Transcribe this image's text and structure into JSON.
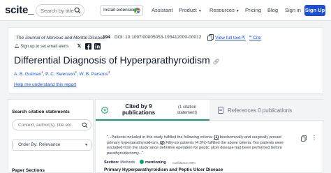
{
  "nav": {
    "logo": "scite_",
    "search_placeholder": "Search by title, ...",
    "extension_label": "Install extension!",
    "items": [
      "Assistant",
      "Product",
      "Resources",
      "Pricing",
      "Blog"
    ],
    "signin": "Sign in",
    "signup": "Sign Up"
  },
  "article": {
    "journal": "The Journal of Nervous and Mental Disease",
    "volume": "194",
    "doi": "DOI: 10.1097/00005053-193412000-00012",
    "full_text": "View full text",
    "cite": "Cite",
    "alerts": "Sign up to set email alerts",
    "title": "Differential Diagnosis of Hyperparathyroidism",
    "authors": [
      {
        "name": "A. B. Gutman",
        "sup": "1"
      },
      {
        "name": "P. C. Swenson",
        "sup": "2"
      },
      {
        "name": "W. B. Parsons",
        "sup": "3"
      }
    ],
    "help": "Help me understand this report"
  },
  "sidebar": {
    "search_title": "Search citation statements",
    "context_placeholder": "Context, author(s), title etc.",
    "order": "Order By: Relevance",
    "sections": "Paper Sections"
  },
  "panel": {
    "tab_cited_main": "Cited by 9 publications",
    "tab_cited_sub": "(1 citation statement)",
    "tab_refs": "References 0 publications",
    "snippet_1": "\"...Patients included in this study fulfilled the following criteria: ",
    "snippet_n1": "(1)",
    "snippet_2": " biochemically and surgically proved primary hyperparathyroid-ism, ",
    "snippet_n2": "(2)",
    "snippet_3": " Fifty-six patients (4.3%) fulfilled the above criteria. Ten patients were excluded from the study since definitive operation for peptic ulcer disease had been performed before parathyroidectomy...\"",
    "section_label": "Section:",
    "section_value": "Methods",
    "mention": "mentioning",
    "confidence": "confidence: 99%",
    "cited_title": "Primary Hyperparathyroidism and Peptic Ulcer Disease"
  }
}
